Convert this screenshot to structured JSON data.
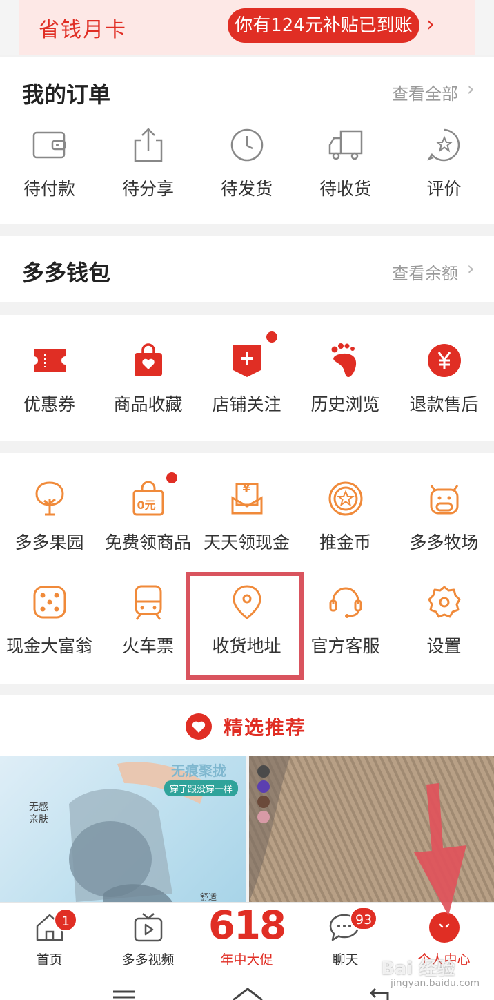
{
  "promo_card": {
    "title": "省钱月卡",
    "pill_text": "你有124元补贴已到账",
    "chevron": "›"
  },
  "orders": {
    "title": "我的订单",
    "link": "查看全部",
    "chevron": "›",
    "items": [
      {
        "label": "待付款",
        "icon": "wallet-icon"
      },
      {
        "label": "待分享",
        "icon": "share-icon"
      },
      {
        "label": "待发货",
        "icon": "clock-icon"
      },
      {
        "label": "待收货",
        "icon": "truck-icon"
      },
      {
        "label": "评价",
        "icon": "review-star-icon"
      }
    ]
  },
  "wallet": {
    "title": "多多钱包",
    "link": "查看余额",
    "chevron": "›"
  },
  "quick": {
    "items": [
      {
        "label": "优惠券",
        "icon": "coupon-icon"
      },
      {
        "label": "商品收藏",
        "icon": "favorite-bag-icon"
      },
      {
        "label": "店铺关注",
        "icon": "store-follow-icon",
        "has_dot": true
      },
      {
        "label": "历史浏览",
        "icon": "footprint-icon"
      },
      {
        "label": "退款售后",
        "icon": "refund-yen-icon"
      }
    ]
  },
  "services": {
    "row1": [
      {
        "label": "多多果园",
        "icon": "tree-icon"
      },
      {
        "label": "免费领商品",
        "icon": "free-bag-icon",
        "icon_text": "0元",
        "has_dot": true
      },
      {
        "label": "天天领现金",
        "icon": "cash-envelope-icon",
        "icon_text": "¥"
      },
      {
        "label": "推金币",
        "icon": "gold-coin-icon"
      },
      {
        "label": "多多牧场",
        "icon": "cow-icon"
      }
    ],
    "row2": [
      {
        "label": "现金大富翁",
        "icon": "dice-icon"
      },
      {
        "label": "火车票",
        "icon": "train-icon"
      },
      {
        "label": "收货地址",
        "icon": "location-pin-icon"
      },
      {
        "label": "官方客服",
        "icon": "headset-icon"
      },
      {
        "label": "设置",
        "icon": "gear-icon"
      }
    ]
  },
  "recommend": {
    "title": "精选推荐"
  },
  "products": [
    {
      "tag_title": "无痕聚拢",
      "tag_sub": "穿了跟没穿一样",
      "tag_side": "无感\n亲肤",
      "tag_corner": "舒适"
    },
    {
      "swatches": [
        "#4a4a4a",
        "#5b3fb0",
        "#6b4a3a",
        "#d79aa6"
      ]
    }
  ],
  "tabbar": {
    "items": [
      {
        "label": "首页",
        "icon": "home-icon",
        "badge": "1"
      },
      {
        "label": "多多视频",
        "icon": "video-icon"
      },
      {
        "label": "年中大促",
        "icon": "promo-618-icon",
        "promo_text": "618"
      },
      {
        "label": "聊天",
        "icon": "chat-icon",
        "badge": "93"
      },
      {
        "label": "个人中心",
        "icon": "profile-icon"
      }
    ]
  },
  "watermark": {
    "text": "Bai 经验",
    "sub": "jingyan.baidu.com"
  },
  "colors": {
    "brand_red": "#e02e24",
    "orange": "#f08a3a",
    "highlight": "#d9545e"
  }
}
